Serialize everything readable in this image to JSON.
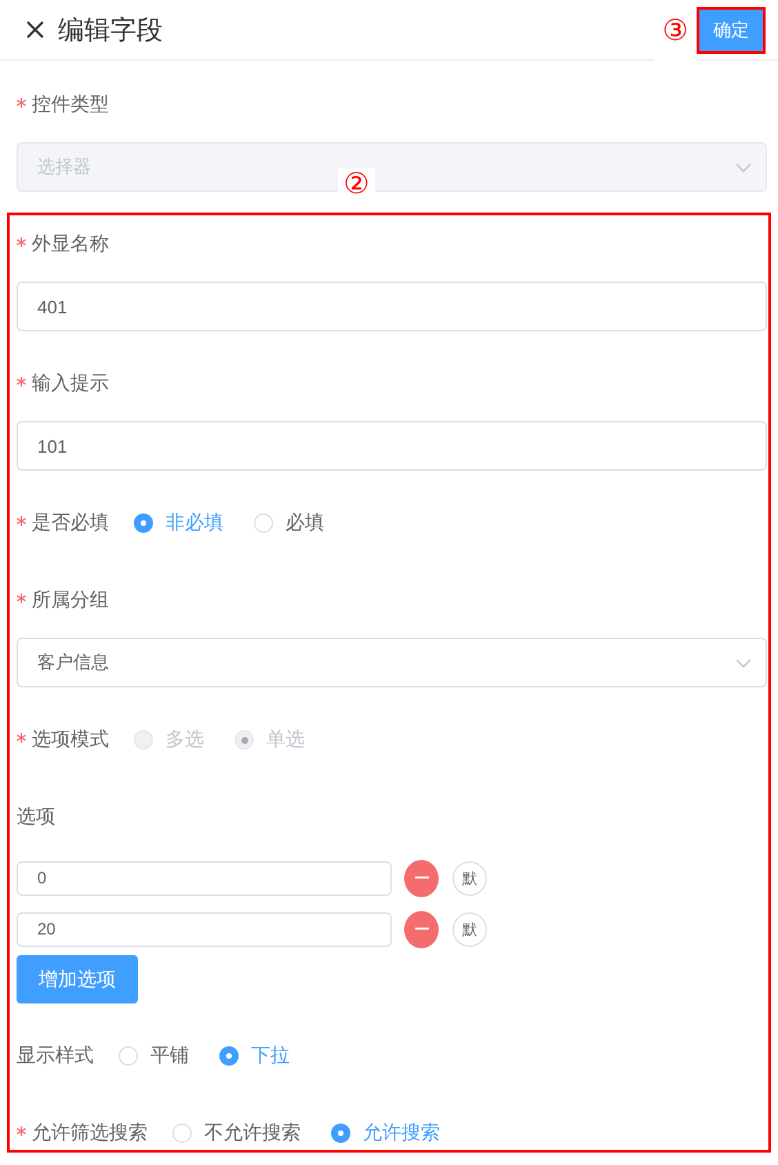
{
  "header": {
    "title": "编辑字段",
    "marker": "③",
    "confirm_button": "确定"
  },
  "fields": [
    {
      "kind": "select",
      "label": "控件类型",
      "required": true,
      "disabled": true,
      "placeholder": "选择器"
    }
  ],
  "highlighted_section": {
    "marker": "②",
    "fields": [
      {
        "kind": "input",
        "label": "外显名称",
        "required": true,
        "value": "401"
      },
      {
        "kind": "input",
        "label": "输入提示",
        "required": true,
        "value": "101"
      },
      {
        "kind": "radio",
        "label": "是否必填",
        "required": true,
        "disabled": false,
        "options": [
          {
            "label": "非必填",
            "selected": true
          },
          {
            "label": "必填",
            "selected": false
          }
        ]
      },
      {
        "kind": "select",
        "label": "所属分组",
        "required": true,
        "disabled": false,
        "value": "客户信息"
      },
      {
        "kind": "radio",
        "label": "选项模式",
        "required": true,
        "disabled": true,
        "options": [
          {
            "label": "多选",
            "selected": false
          },
          {
            "label": "单选",
            "selected": true
          }
        ]
      },
      {
        "kind": "options",
        "label": "选项",
        "required": false,
        "items": [
          {
            "value": "0",
            "default_label": "默"
          },
          {
            "value": "20",
            "default_label": "默"
          }
        ],
        "add_button": "增加选项"
      },
      {
        "kind": "radio",
        "label": "显示样式",
        "required": false,
        "disabled": false,
        "options": [
          {
            "label": "平铺",
            "selected": false
          },
          {
            "label": "下拉",
            "selected": true
          }
        ]
      },
      {
        "kind": "radio",
        "label": "允许筛选搜索",
        "required": true,
        "disabled": false,
        "options": [
          {
            "label": "不允许搜索",
            "selected": false
          },
          {
            "label": "允许搜索",
            "selected": true
          }
        ]
      }
    ]
  }
}
